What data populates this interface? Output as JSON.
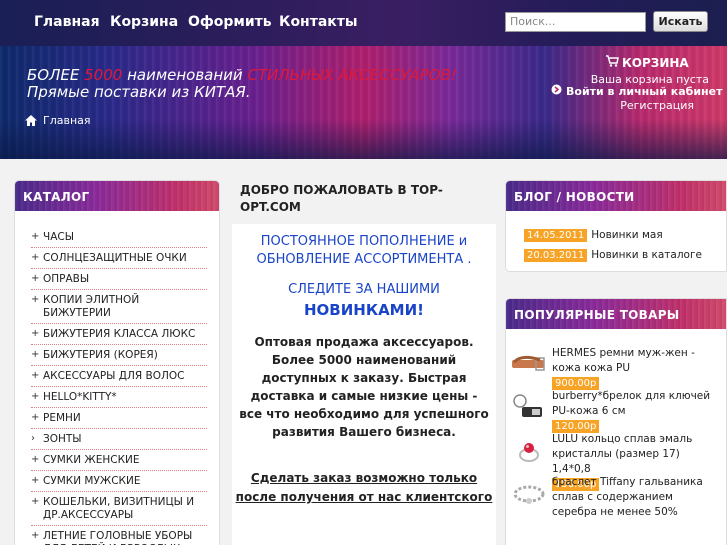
{
  "nav": {
    "items": [
      "Главная",
      "Корзина",
      "Оформить",
      "Контакты"
    ],
    "search_placeholder": "Поиск...",
    "search_button": "Искать"
  },
  "banner": {
    "slogan_part1": "БОЛЕЕ ",
    "slogan_number": "5000",
    "slogan_part2": " наименований ",
    "slogan_highlight": "СТИЛЬНЫХ АКСЕССУАРОВ!",
    "slogan_line2": "Прямые поставки из КИТАЯ.",
    "breadcrumb": "Главная",
    "cart_title": "КОРЗИНА",
    "cart_status": "Ваша корзина пуста",
    "login": "Войти в личный кабинет",
    "register": "Регистрация"
  },
  "catalog": {
    "title": "КАТАЛОГ",
    "items": [
      {
        "bullet": "+",
        "label": "ЧАСЫ"
      },
      {
        "bullet": "+",
        "label": "СОЛНЦЕЗАЩИТНЫЕ ОЧКИ"
      },
      {
        "bullet": "+",
        "label": "ОПРАВЫ"
      },
      {
        "bullet": "+",
        "label": "КОПИИ ЭЛИТНОЙ БИЖУТЕРИИ"
      },
      {
        "bullet": "+",
        "label": "БИЖУТЕРИЯ КЛАССА ЛЮКС"
      },
      {
        "bullet": "+",
        "label": "БИЖУТЕРИЯ (КОРЕЯ)"
      },
      {
        "bullet": "+",
        "label": "АКСЕССУАРЫ ДЛЯ ВОЛОС"
      },
      {
        "bullet": "+",
        "label": "HELLO*KITTY*"
      },
      {
        "bullet": "+",
        "label": "РЕМНИ"
      },
      {
        "bullet": "›",
        "label": "ЗОНТЫ"
      },
      {
        "bullet": "+",
        "label": "СУМКИ ЖЕНСКИЕ"
      },
      {
        "bullet": "+",
        "label": "СУМКИ МУЖСКИЕ"
      },
      {
        "bullet": "+",
        "label": "КОШЕЛЬКИ, ВИЗИТНИЦЫ И ДР.АКСЕССУАРЫ"
      },
      {
        "bullet": "+",
        "label": "ЛЕТНИЕ ГОЛОВНЫЕ УБОРЫ ДЛЯ ДЕТЕЙ И ВЗРОСЛЫХ"
      }
    ]
  },
  "main": {
    "welcome": "ДОБРО ПОЖАЛОВАТЬ В TOP-OPT.COM",
    "blue1": "ПОСТОЯННОЕ ПОПОЛНЕНИЕ и ОБНОВЛЕНИЕ АССОРТИМЕНТА .",
    "blue2": "СЛЕДИТЕ ЗА НАШИМИ",
    "blue3": "НОВИНКАМИ!",
    "text1": "Оптовая продажа аксессуаров. Более 5000 наименований доступных к заказу. Быстрая доставка и самые низкие цены  - все что необходимо для успешного развития Вашего бизнеса.",
    "text2": "Сделать заказ возможно только после получения от нас клиентского"
  },
  "blog": {
    "title": "БЛОГ / НОВОСТИ",
    "items": [
      {
        "date": "14.05.2011",
        "title": "Новинки мая"
      },
      {
        "date": "20.03.2011",
        "title": "Новинки в каталоге"
      }
    ]
  },
  "popular": {
    "title": "ПОПУЛЯРНЫЕ ТОВАРЫ",
    "items": [
      {
        "name": "HERMES ремни муж-жен - кожа кожа PU",
        "price": "900.00р",
        "icon": "belt-thumbnail"
      },
      {
        "name": "burberry*брелок для ключей PU-кожа 6 см",
        "price": "120.00р",
        "icon": "keychain-thumbnail"
      },
      {
        "name": "LULU кольцо сплав эмаль кристаллы (размер 17) 1,4*0,8",
        "price": "150.00р",
        "icon": "ring-thumbnail"
      },
      {
        "name": "браслет Tiffany гальваника сплав с содержанием серебра не менее 50%",
        "price": "",
        "icon": "bracelet-thumbnail"
      }
    ]
  },
  "colors": {
    "accent_blue": "#1a44c8",
    "price_orange": "#f7a325",
    "slogan_red": "#e0183a"
  }
}
